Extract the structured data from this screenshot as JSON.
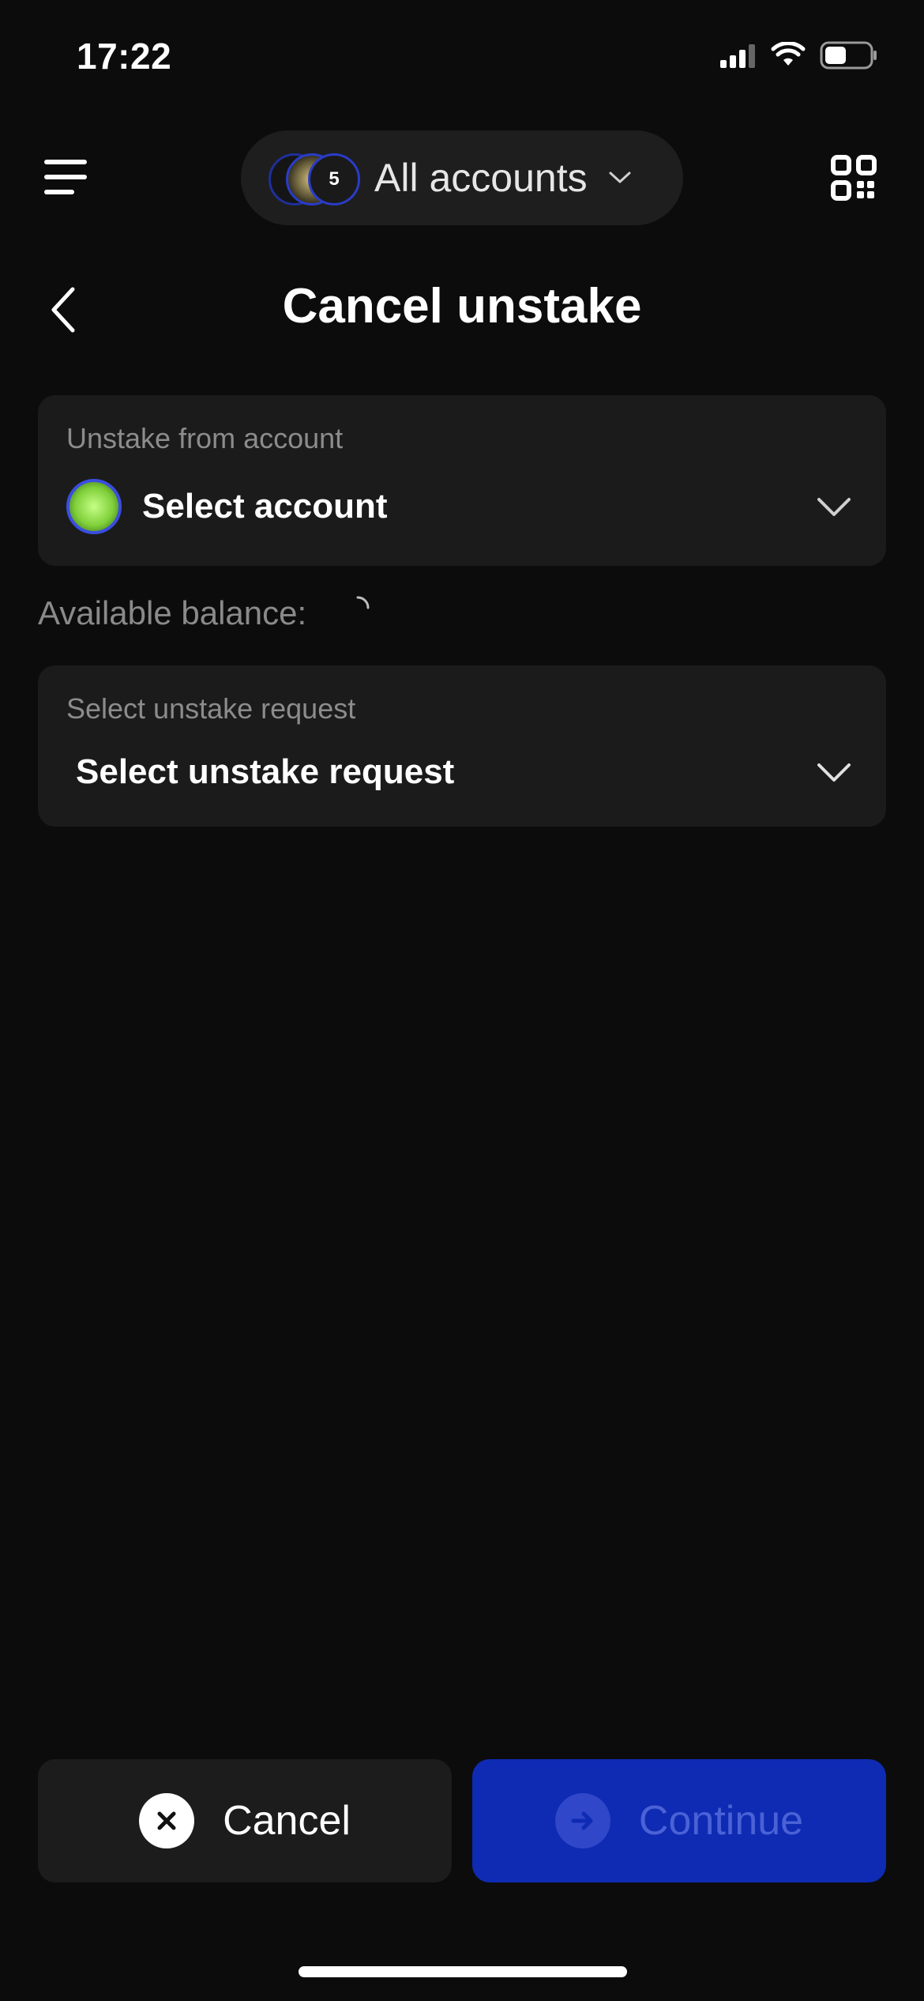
{
  "status_bar": {
    "time": "17:22"
  },
  "top_nav": {
    "account_switcher_label": "All accounts",
    "avatar_badge": "5"
  },
  "header": {
    "title": "Cancel unstake"
  },
  "unstake_from": {
    "label": "Unstake from account",
    "value": "Select account"
  },
  "balance": {
    "label": "Available balance:"
  },
  "unstake_request": {
    "label": "Select unstake request",
    "value": "Select unstake request"
  },
  "actions": {
    "cancel_label": "Cancel",
    "continue_label": "Continue"
  },
  "icons": {
    "menu": "menu-icon",
    "qr": "qr-code-icon",
    "back": "chevron-left-icon",
    "chevron": "chevron-down-icon",
    "close": "close-icon",
    "arrow": "arrow-right-icon"
  },
  "colors": {
    "background": "#0c0c0c",
    "card": "#1b1b1b",
    "accent": "#0f2bb3",
    "muted_text": "#8c8c8c"
  }
}
